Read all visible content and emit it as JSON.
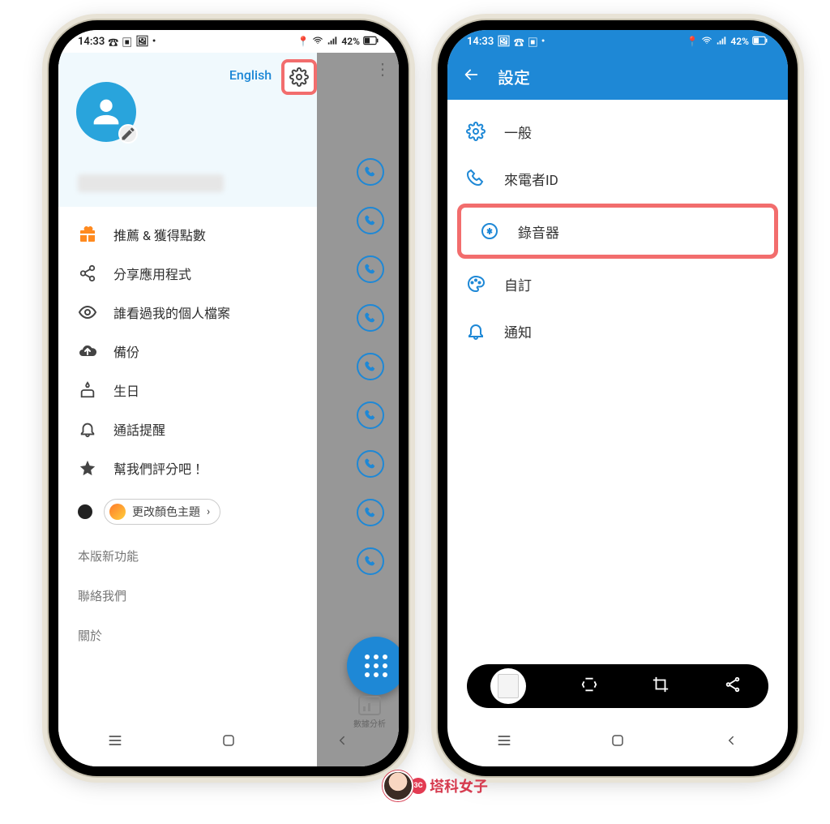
{
  "status": {
    "time": "14:33",
    "battery": "42%"
  },
  "left": {
    "lang_label": "English",
    "menu": [
      {
        "label": "推薦 & 獲得點數"
      },
      {
        "label": "分享應用程式"
      },
      {
        "label": "誰看過我的個人檔案"
      },
      {
        "label": "備份"
      },
      {
        "label": "生日"
      },
      {
        "label": "通話提醒"
      },
      {
        "label": "幫我們評分吧！"
      }
    ],
    "theme_label": "更改顏色主題",
    "footer": [
      {
        "label": "本版新功能"
      },
      {
        "label": "聯絡我們"
      },
      {
        "label": "關於"
      }
    ],
    "analytics_label": "數據分析"
  },
  "right": {
    "title": "設定",
    "items": [
      {
        "label": "一般"
      },
      {
        "label": "來電者ID"
      },
      {
        "label": "錄音器"
      },
      {
        "label": "自訂"
      },
      {
        "label": "通知"
      }
    ]
  },
  "watermark": {
    "text": "塔科女子",
    "badge": "3C"
  }
}
